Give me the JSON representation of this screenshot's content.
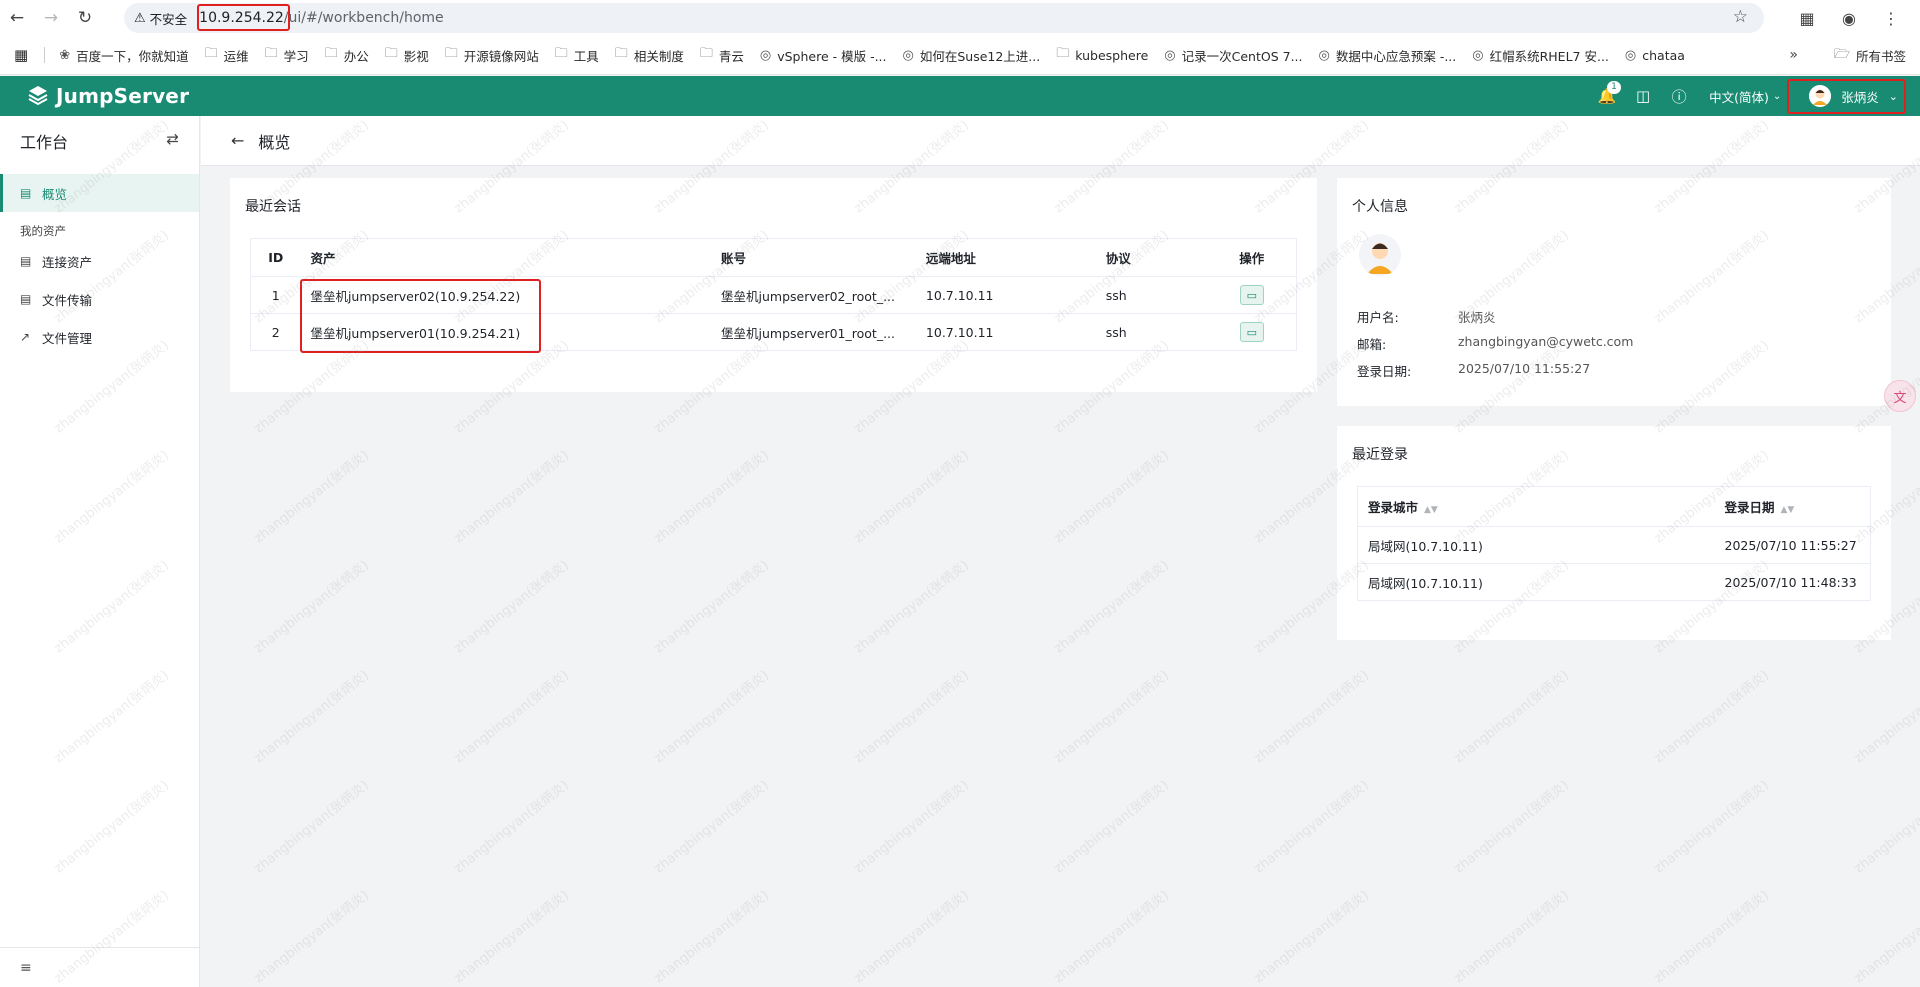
{
  "browser": {
    "insecure_label": "不安全",
    "url_host": "10.9.254.22",
    "url_path": "/ui/#/workbench/home",
    "bookmarks": [
      {
        "icon": "paw-icon",
        "label": "百度一下，你就知道"
      },
      {
        "icon": "folder-icon",
        "label": "运维"
      },
      {
        "icon": "folder-icon",
        "label": "学习"
      },
      {
        "icon": "folder-icon",
        "label": "办公"
      },
      {
        "icon": "folder-icon",
        "label": "影视"
      },
      {
        "icon": "folder-icon",
        "label": "开源镜像网站"
      },
      {
        "icon": "folder-icon",
        "label": "工具"
      },
      {
        "icon": "folder-icon",
        "label": "相关制度"
      },
      {
        "icon": "folder-icon",
        "label": "青云"
      },
      {
        "icon": "globe-icon",
        "label": "vSphere - 模版 -..."
      },
      {
        "icon": "globe-icon",
        "label": "如何在Suse12上进..."
      },
      {
        "icon": "folder-icon",
        "label": "kubesphere"
      },
      {
        "icon": "globe-icon",
        "label": "记录一次CentOS 7..."
      },
      {
        "icon": "globe-icon",
        "label": "数据中心应急预案 -..."
      },
      {
        "icon": "globe-icon",
        "label": "红帽系统RHEL7 安..."
      },
      {
        "icon": "globe-icon",
        "label": "chataa"
      }
    ],
    "all_bookmarks": "所有书签"
  },
  "header": {
    "brand": "JumpServer",
    "notification_count": "1",
    "language": "中文(简体)",
    "user_name": "张炳炎"
  },
  "sidebar": {
    "title": "工作台",
    "overview": "概览",
    "group_label": "我的资产",
    "items": [
      "连接资产",
      "文件传输",
      "文件管理"
    ]
  },
  "page": {
    "title": "概览"
  },
  "recent_sessions": {
    "title": "最近会话",
    "columns": [
      "ID",
      "资产",
      "账号",
      "远端地址",
      "协议",
      "操作"
    ],
    "rows": [
      {
        "id": "1",
        "asset": "堡垒机jumpserver02(10.9.254.22)",
        "account": "堡垒机jumpserver02_root_...",
        "address": "10.7.10.11",
        "protocol": "ssh"
      },
      {
        "id": "2",
        "asset": "堡垒机jumpserver01(10.9.254.21)",
        "account": "堡垒机jumpserver01_root_...",
        "address": "10.7.10.11",
        "protocol": "ssh"
      }
    ]
  },
  "profile": {
    "title": "个人信息",
    "username_label": "用户名:",
    "username": "张炳炎",
    "email_label": "邮箱:",
    "email": "zhangbingyan@cywetc.com",
    "login_date_label": "登录日期:",
    "login_date": "2025/07/10 11:55:27"
  },
  "recent_logins": {
    "title": "最近登录",
    "columns": [
      "登录城市",
      "登录日期"
    ],
    "rows": [
      {
        "city": "局域网(10.7.10.11)",
        "date": "2025/07/10 11:55:27"
      },
      {
        "city": "局域网(10.7.10.11)",
        "date": "2025/07/10 11:48:33"
      }
    ]
  },
  "watermark_text": "zhangbingyan(张炳炎)",
  "colors": {
    "brand": "#1a8b73",
    "highlight": "#e02020"
  }
}
